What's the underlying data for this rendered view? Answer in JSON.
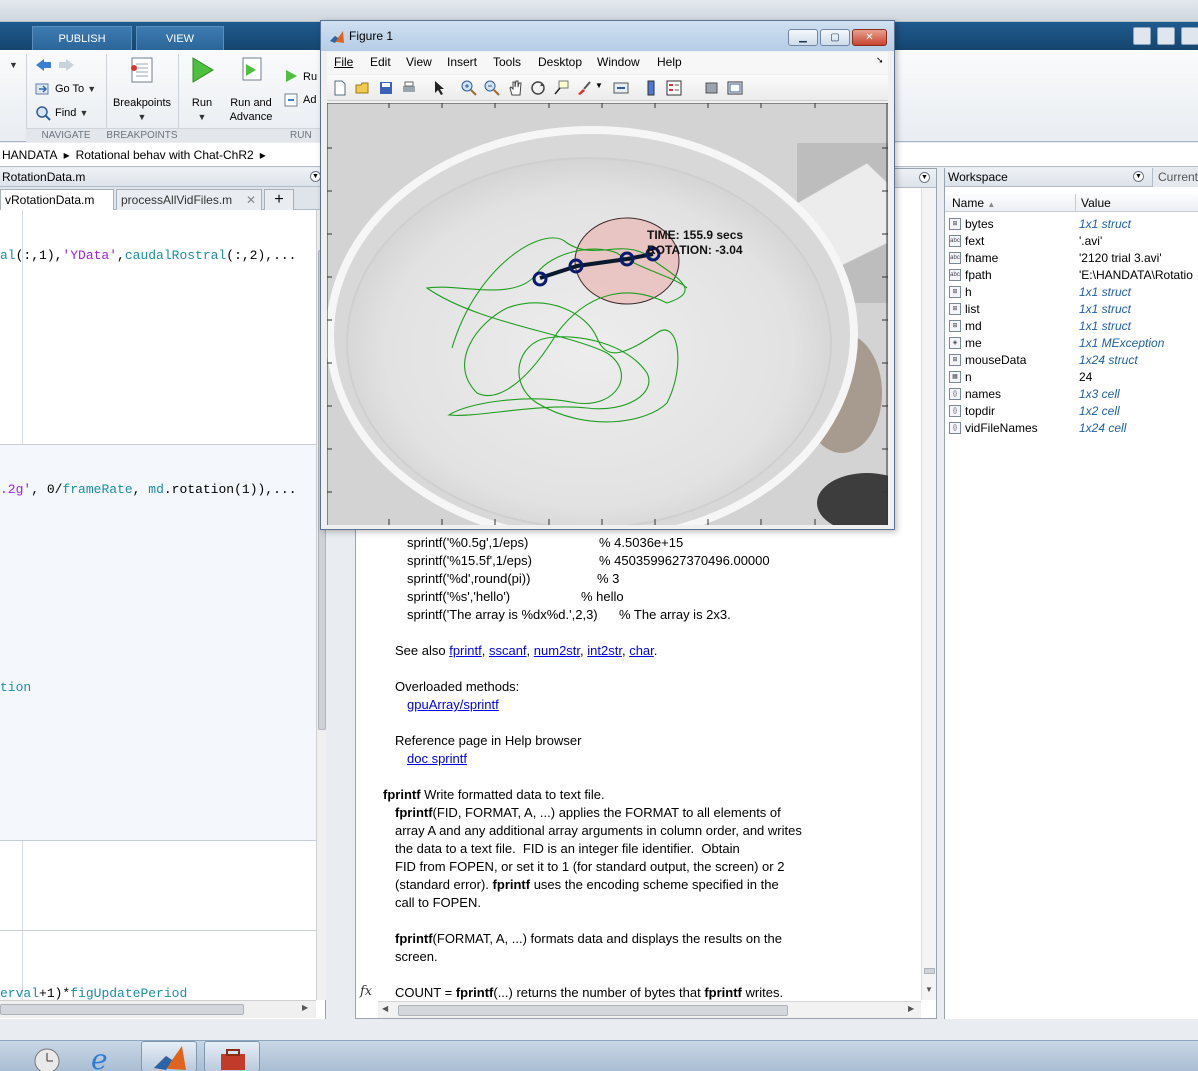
{
  "ribbon": {
    "tabs": [
      "PUBLISH",
      "VIEW"
    ],
    "navigate": {
      "goto_label": "Go To",
      "find_label": "Find",
      "section": "NAVIGATE"
    },
    "breakpoints": {
      "label": "Breakpoints",
      "section": "BREAKPOINTS"
    },
    "run": {
      "run_label": "Run",
      "run_advance_label_1": "Run and",
      "run_advance_label_2": "Advance",
      "run_section_small_1": "Ru",
      "run_section_small_2": "Ad",
      "section": "RUN"
    }
  },
  "address": {
    "part1": "HANDATA",
    "part2": "Rotational behav with Chat-ChR2"
  },
  "editor": {
    "title": "RotationData.m",
    "tabs": [
      "vRotationData.m",
      "processAllVidFiles.m"
    ],
    "code": {
      "line1_a": "al",
      "line1_b": "(:,1),",
      "line1_c": "'YData'",
      "line1_d": ",",
      "line1_e": "caudalRostral",
      "line1_f": "(:,2),...",
      "line2_a": ".2g'",
      "line2_b": ", 0/",
      "line2_c": "frameRate",
      "line2_d": ", ",
      "line2_e": "md",
      "line2_f": ".rotation(1)),...",
      "line3": "tion",
      "line4_a": "erval",
      "line4_b": "+1)*",
      "line4_c": "figUpdatePeriod"
    }
  },
  "cmd": {
    "lines": {
      "l1_a": "sprintf('%0.5g',1/eps)",
      "l1_b": "% 4.5036e+15",
      "l2_a": "sprintf('%15.5f',1/eps)",
      "l2_b": "% 4503599627370496.00000",
      "l3_a": "sprintf('%d',round(pi))",
      "l3_b": "% 3",
      "l4_a": "sprintf('%s','hello')",
      "l4_b": "% hello",
      "l5_a": "sprintf('The array is %dx%d.',2,3)",
      "l5_b": "% The array is 2x3.",
      "seealso": "See also",
      "seealso_links": [
        "fprintf",
        "sscanf",
        "num2str",
        "int2str",
        "char"
      ],
      "overloaded": "Overloaded methods:",
      "overloaded_link": "gpuArray/sprintf",
      "refpage": "Reference page in Help browser",
      "refpage_link": "doc sprintf",
      "fp_head_bold": "fprintf",
      "fp_head_rest": " Write formatted data to text file.",
      "fp1_bold": "fprintf",
      "fp1_rest": "(FID, FORMAT, A, ...) applies the FORMAT to all elements of",
      "fp2": "array A and any additional array arguments in column order, and writes",
      "fp3": "the data to a text file.  FID is an integer file identifier.  Obtain",
      "fp4": "FID from FOPEN, or set it to 1 (for standard output, the screen) or 2",
      "fp5_a": "(standard error). ",
      "fp5_bold": "fprintf",
      "fp5_b": " uses the encoding scheme specified in the",
      "fp6": "call to FOPEN.",
      "fp7_bold": "fprintf",
      "fp7_rest": "(FORMAT, A, ...) formats data and displays the results on the",
      "fp8": "screen.",
      "fp9_a": "COUNT = ",
      "fp9_bold1": "fprintf",
      "fp9_b": "(...) returns the number of bytes that ",
      "fp9_bold2": "fprintf",
      "fp9_c": " writes."
    }
  },
  "workspace": {
    "title": "Workspace",
    "current": "Current",
    "col_name": "Name",
    "col_value": "Value",
    "rows": [
      {
        "icon": "struct",
        "name": "bytes",
        "value": "1x1 struct",
        "italic": true
      },
      {
        "icon": "char",
        "name": "fext",
        "value": "'.avi'",
        "italic": false
      },
      {
        "icon": "char",
        "name": "fname",
        "value": "'2120 trial 3.avi'",
        "italic": false
      },
      {
        "icon": "char",
        "name": "fpath",
        "value": "'E:\\HANDATA\\Rotatio",
        "italic": false
      },
      {
        "icon": "struct",
        "name": "h",
        "value": "1x1 struct",
        "italic": true
      },
      {
        "icon": "struct",
        "name": "list",
        "value": "1x1 struct",
        "italic": true
      },
      {
        "icon": "struct",
        "name": "md",
        "value": "1x1 struct",
        "italic": true
      },
      {
        "icon": "object",
        "name": "me",
        "value": "1x1 MException",
        "italic": true
      },
      {
        "icon": "struct",
        "name": "mouseData",
        "value": "1x24 struct",
        "italic": true
      },
      {
        "icon": "numeric",
        "name": "n",
        "value": "24",
        "italic": false
      },
      {
        "icon": "cell",
        "name": "names",
        "value": "1x3 cell",
        "italic": true
      },
      {
        "icon": "cell",
        "name": "topdir",
        "value": "1x2 cell",
        "italic": true
      },
      {
        "icon": "cell",
        "name": "vidFileNames",
        "value": "1x24 cell",
        "italic": true
      }
    ]
  },
  "figure": {
    "title": "Figure 1",
    "menus": [
      "File",
      "Edit",
      "View",
      "Insert",
      "Tools",
      "Desktop",
      "Window",
      "Help"
    ],
    "overlay_time": "TIME: 155.9 secs",
    "overlay_rotation": "ROTATION: -3.04"
  },
  "colors": {
    "accent": "#1f5a8e",
    "link": "#0000ee",
    "trace": "#1e9e1e",
    "markers": "#0a1a6e"
  }
}
